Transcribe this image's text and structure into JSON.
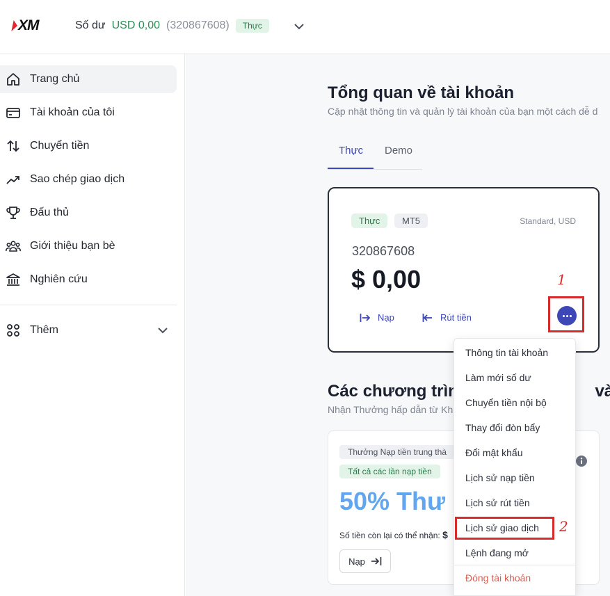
{
  "header": {
    "logo_text": "XM",
    "balance_label": "Số dư",
    "balance_amount": "USD 0,00",
    "account_id": "(320867608)",
    "account_type_badge": "Thực"
  },
  "sidebar": {
    "items": [
      {
        "label": "Trang chủ",
        "icon": "home-icon"
      },
      {
        "label": "Tài khoản của tôi",
        "icon": "card-icon"
      },
      {
        "label": "Chuyển tiền",
        "icon": "transfer-icon"
      },
      {
        "label": "Sao chép giao dịch",
        "icon": "trend-icon"
      },
      {
        "label": "Đấu thủ",
        "icon": "trophy-icon"
      },
      {
        "label": "Giới thiệu bạn bè",
        "icon": "people-icon"
      },
      {
        "label": "Nghiên cứu",
        "icon": "bank-icon"
      }
    ],
    "more_label": "Thêm"
  },
  "main": {
    "title": "Tổng quan về tài khoản",
    "subtitle": "Cập nhật thông tin và quản lý tài khoản của bạn một cách dễ d",
    "tabs": [
      {
        "label": "Thực"
      },
      {
        "label": "Demo"
      }
    ],
    "account_card": {
      "badge_real": "Thực",
      "badge_platform": "MT5",
      "account_type": "Standard, USD",
      "account_number": "320867608",
      "balance": "$ 0,00",
      "deposit_label": "Nạp",
      "withdraw_label": "Rút tiền"
    },
    "promo": {
      "title": "Các chương trình",
      "title_end": "và Th",
      "subtitle": "Nhận Thưởng hấp dẫn từ Kh",
      "tag1": "Thưởng Nạp tiền trung thà",
      "tag2": "Tất cả các lần nạp tiền",
      "big_text": "50% Thư",
      "remaining_label": "Số tiền còn lại có thể nhận:",
      "remaining_value": "$",
      "deposit_button": "Nạp"
    }
  },
  "dropdown": {
    "items": [
      "Thông tin tài khoản",
      "Làm mới số dư",
      "Chuyển tiền nội bộ",
      "Thay đổi đòn bẩy",
      "Đổi mật khẩu",
      "Lịch sử nạp tiền",
      "Lịch sử rút tiền",
      "Lịch sử giao dịch",
      "Lệnh đang mở"
    ],
    "danger_item": "Đóng tài khoản"
  },
  "annotations": {
    "step1": "1",
    "step2": "2"
  },
  "colors": {
    "accent": "#3d47b6",
    "success": "#2f8a57",
    "highlight": "#d72a2a",
    "danger": "#e05a4e"
  }
}
